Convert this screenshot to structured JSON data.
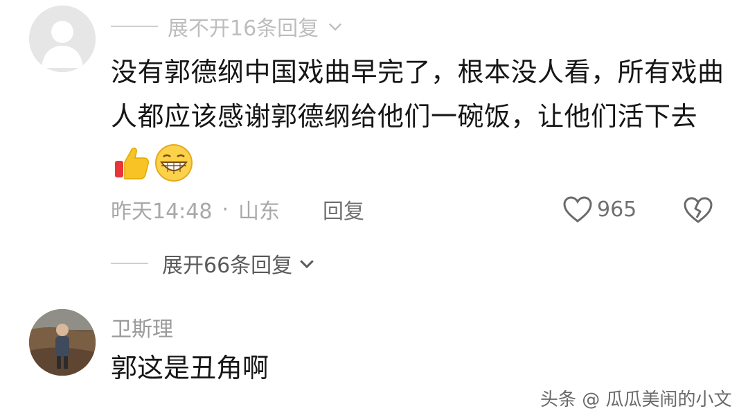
{
  "thread": {
    "collapsed_replies_label": "展不开16条回复"
  },
  "comment1": {
    "avatar_icon": "default-avatar-icon",
    "text": "没有郭德纲中国戏曲早完了，根本没人看，所有戏曲人都应该感谢郭德纲给他们一碗饭，让他们活下去",
    "emojis": [
      "thumbs-up-emoji",
      "grinning-face-emoji"
    ],
    "time": "昨天14:48",
    "location": "山东",
    "dot": "·",
    "reply_label": "回复",
    "like_count": "965",
    "like_icon": "heart-icon",
    "dislike_icon": "broken-heart-icon"
  },
  "expand_replies": {
    "label": "展开66条回复"
  },
  "comment2": {
    "username": "卫斯理",
    "text": "郭这是丑角啊"
  },
  "watermark": {
    "text": "头条 @ 瓜瓜美闹的小文"
  }
}
